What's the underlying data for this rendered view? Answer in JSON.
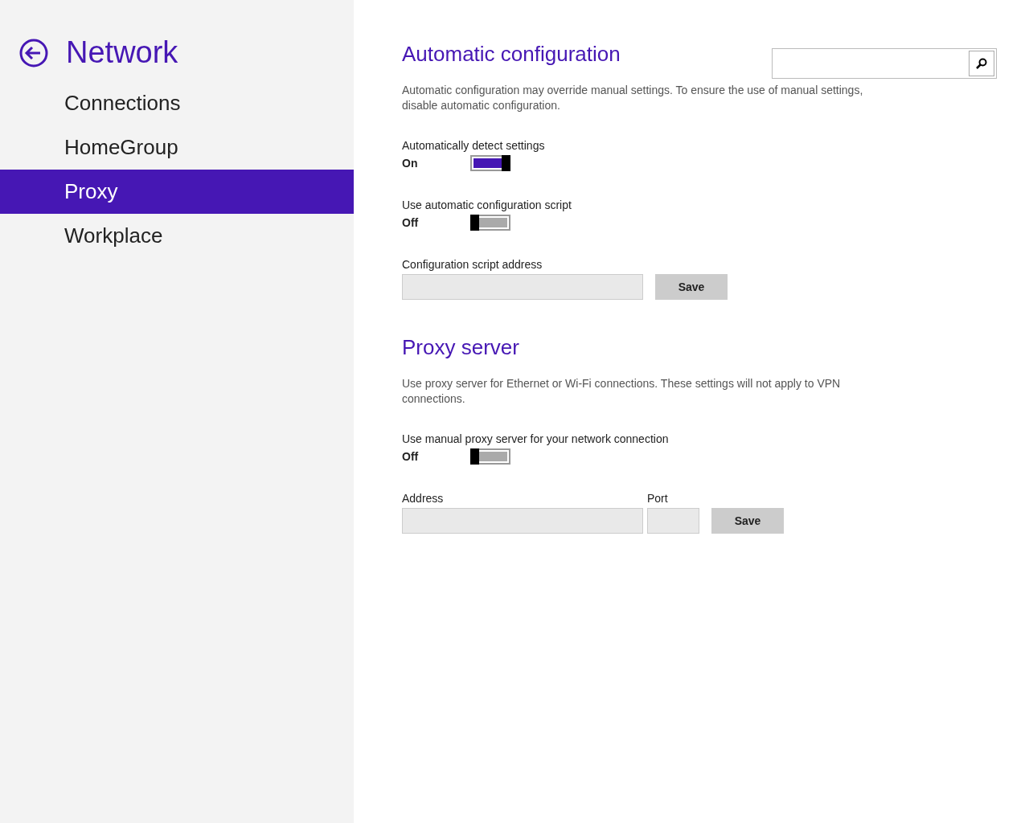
{
  "sidebar": {
    "title": "Network",
    "items": [
      {
        "label": "Connections",
        "selected": false
      },
      {
        "label": "HomeGroup",
        "selected": false
      },
      {
        "label": "Proxy",
        "selected": true
      },
      {
        "label": "Workplace",
        "selected": false
      }
    ]
  },
  "sections": [
    {
      "heading": "Automatic configuration",
      "description": "Automatic configuration may override manual settings. To ensure the use of manual settings, disable automatic configuration.",
      "controls": [
        {
          "kind": "toggle",
          "label": "Automatically detect settings",
          "state_text": "On",
          "on": true
        },
        {
          "kind": "toggle",
          "label": "Use automatic configuration script",
          "state_text": "Off",
          "on": false
        },
        {
          "kind": "fields",
          "fields": [
            {
              "label": "Configuration script address",
              "kind": "wide"
            }
          ],
          "button": "Save"
        }
      ]
    },
    {
      "heading": "Proxy server",
      "description": "Use proxy server for Ethernet or Wi-Fi connections. These settings will not apply to VPN connections.",
      "controls": [
        {
          "kind": "toggle",
          "label": "Use manual proxy server for your network connection",
          "state_text": "Off",
          "on": false
        },
        {
          "kind": "fields",
          "fields": [
            {
              "label": "Address",
              "kind": "wide"
            },
            {
              "label": "Port",
              "kind": "narrow"
            }
          ],
          "button": "Save"
        }
      ]
    }
  ]
}
